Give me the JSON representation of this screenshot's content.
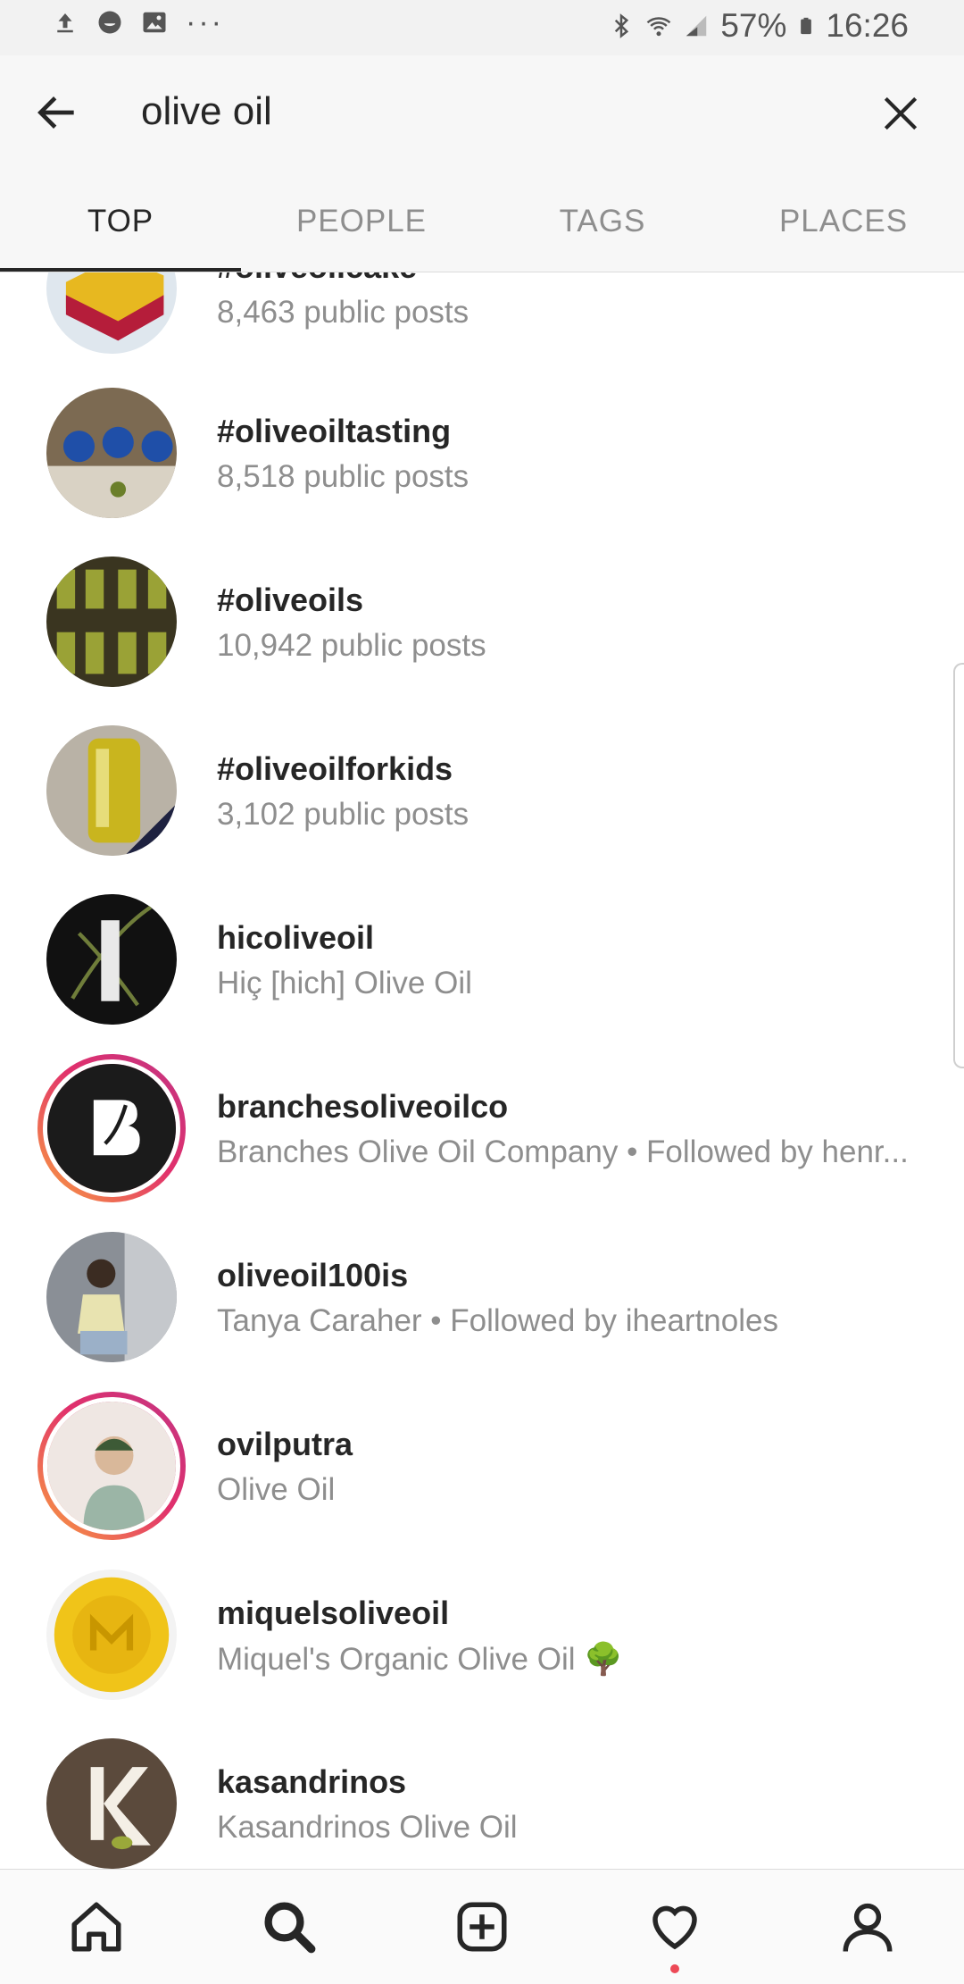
{
  "status_bar": {
    "battery": "57%",
    "time": "16:26",
    "icons": [
      "upload-icon",
      "face-icon",
      "image-icon",
      "more-dots-icon",
      "bluetooth-icon",
      "wifi-icon",
      "signal-icon",
      "battery-icon"
    ]
  },
  "search": {
    "query": "olive oil"
  },
  "tabs": [
    "TOP",
    "PEOPLE",
    "TAGS",
    "PLACES"
  ],
  "results": [
    {
      "title": "#oliveoilcake",
      "subtitle": "8,463 public posts"
    },
    {
      "title": "#oliveoiltasting",
      "subtitle": "8,518 public posts"
    },
    {
      "title": "#oliveoils",
      "subtitle": "10,942 public posts"
    },
    {
      "title": "#oliveoilforkids",
      "subtitle": "3,102 public posts"
    },
    {
      "title": "hicoliveoil",
      "subtitle": "Hiç [hich] Olive Oil"
    },
    {
      "title": "branchesoliveoilco",
      "subtitle": "Branches Olive Oil Company • Followed by henr..."
    },
    {
      "title": "oliveoil100is",
      "subtitle": "Tanya Caraher • Followed by iheartnoles"
    },
    {
      "title": "ovilputra",
      "subtitle": "Olive Oil"
    },
    {
      "title": "miquelsoliveoil",
      "subtitle": "Miquel's Organic Olive Oil 🌳"
    },
    {
      "title": "kasandrinos",
      "subtitle": "Kasandrinos Olive Oil"
    }
  ],
  "bottom_nav": [
    "home-icon",
    "search-icon",
    "new-post-icon",
    "activity-heart-icon",
    "profile-icon"
  ],
  "colors": {
    "accent_ring_start": "#f9a03f",
    "accent_ring_end": "#c13584",
    "notification": "#ed4956"
  }
}
